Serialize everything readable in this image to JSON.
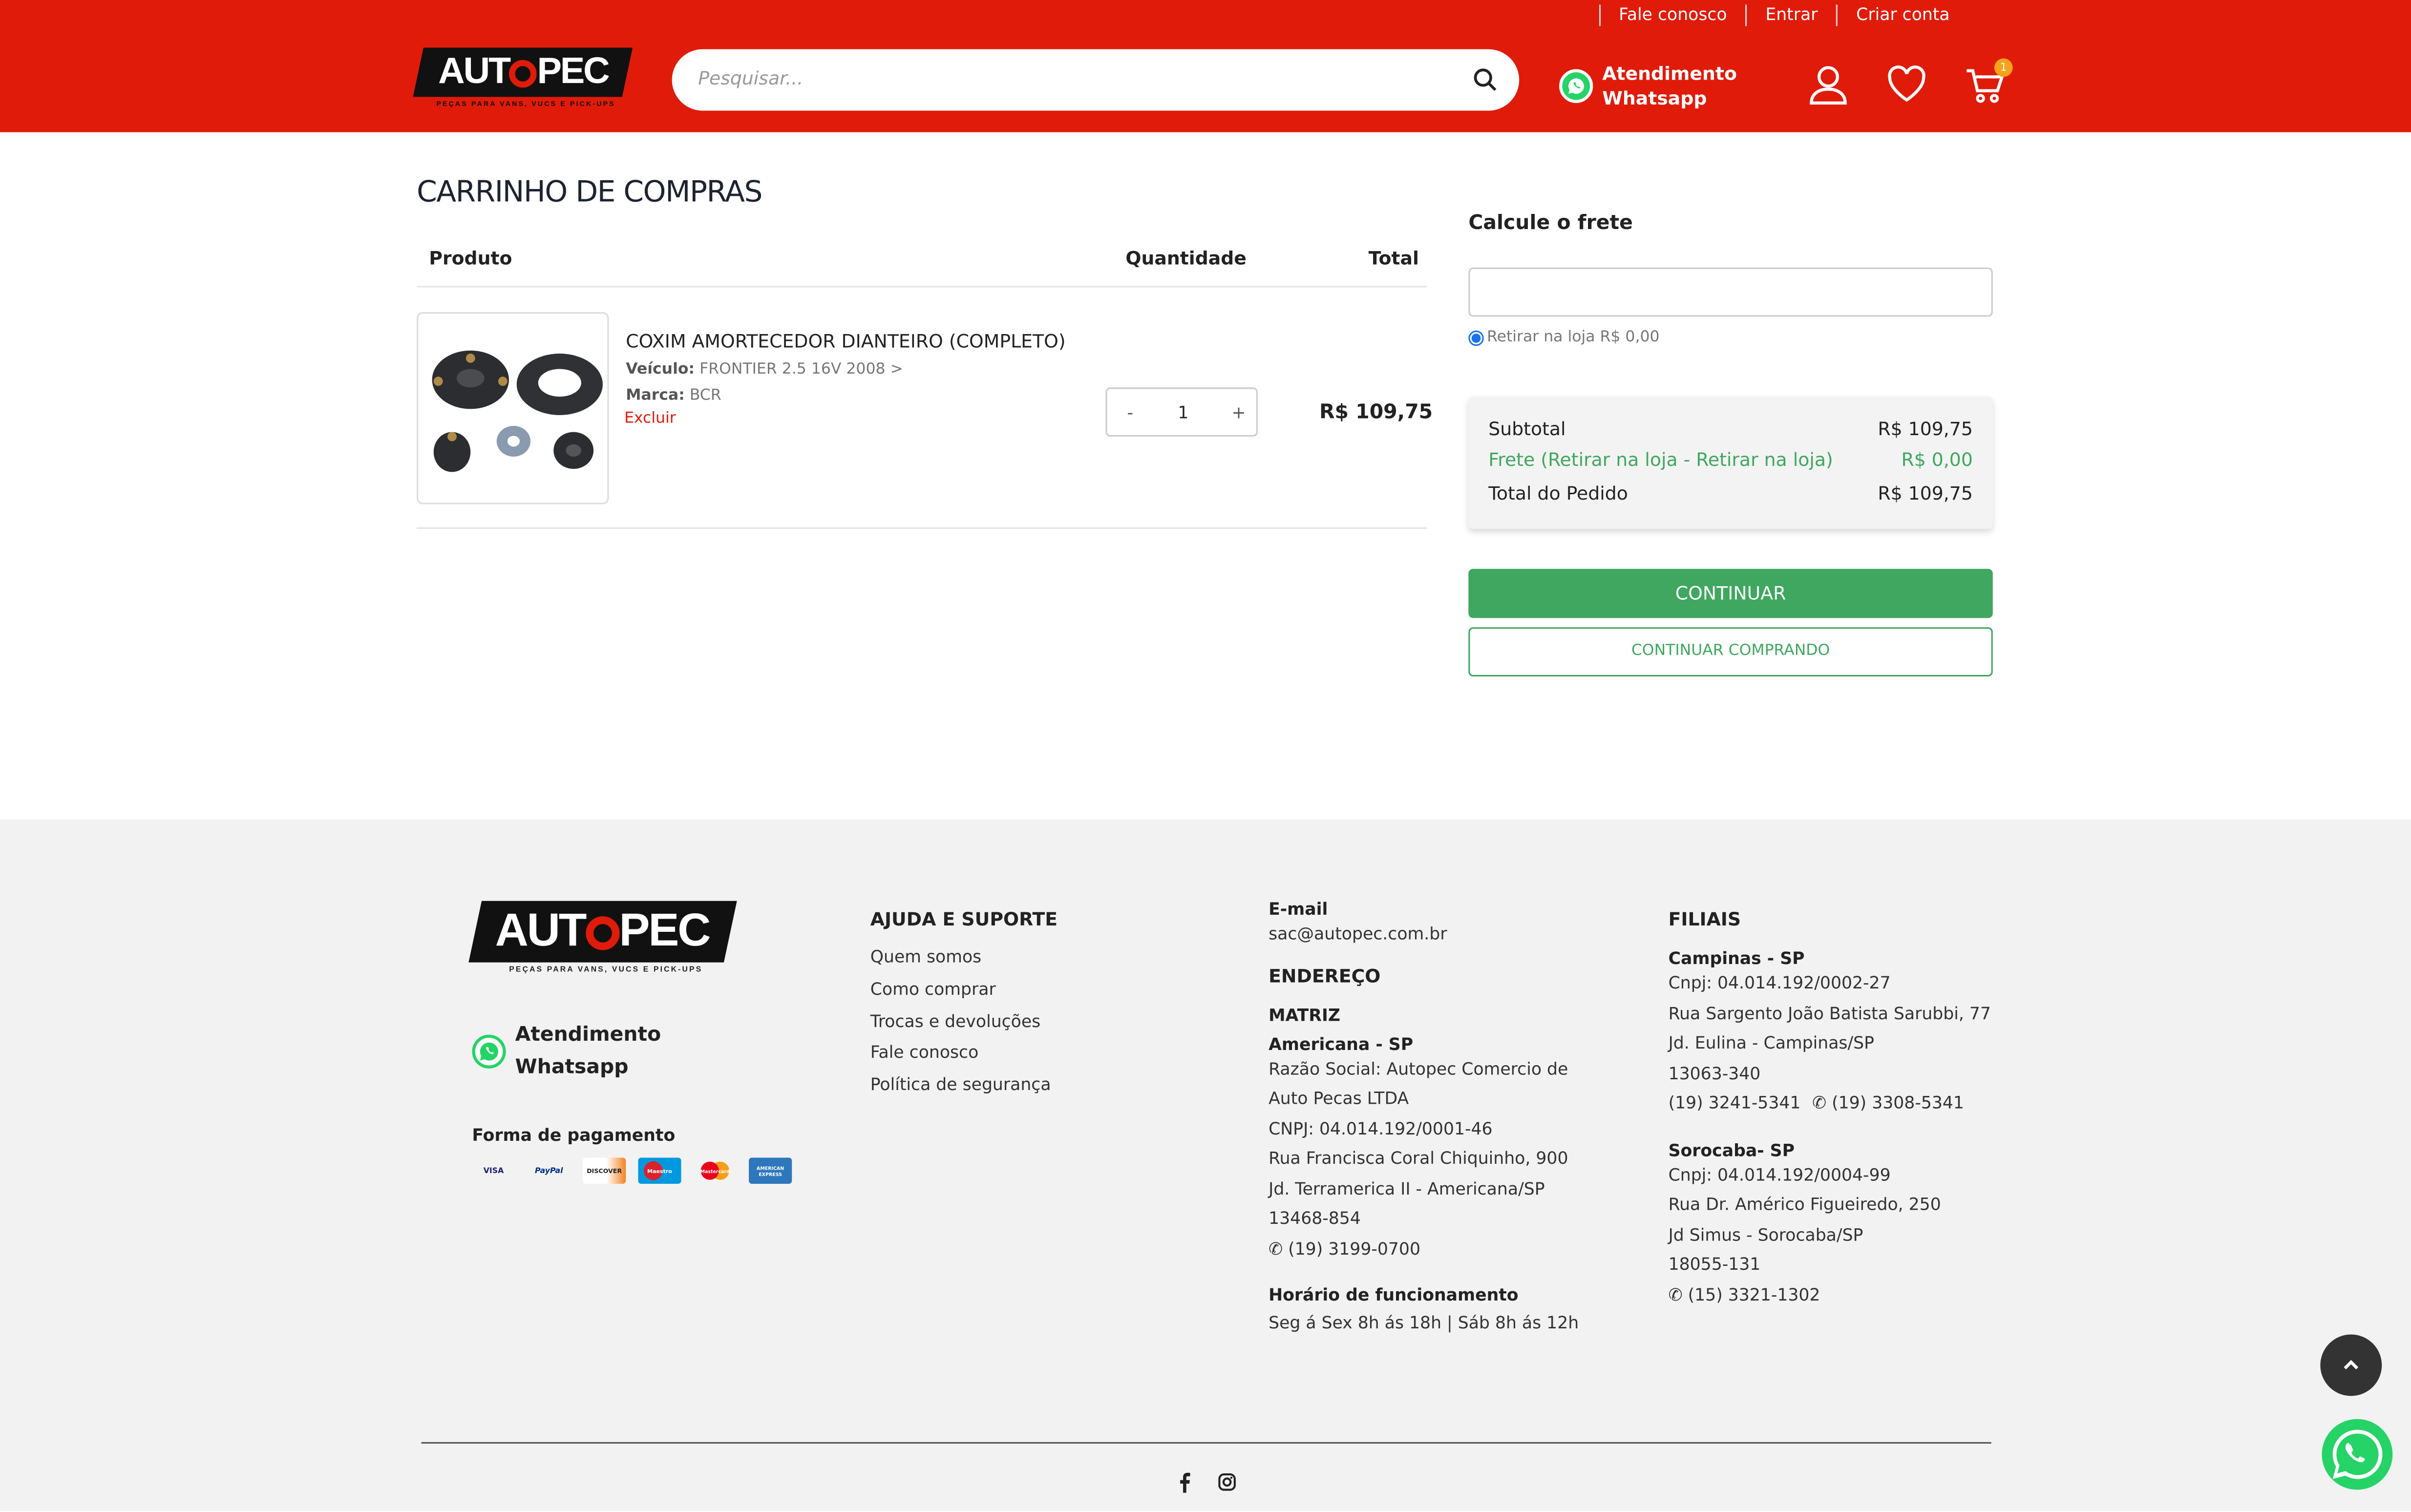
{
  "header": {
    "top_links": [
      "Fale conosco",
      "Entrar",
      "Criar conta"
    ],
    "logo_text_left": "AUT",
    "logo_text_right": "PEC",
    "logo_tagline": "PEÇAS PARA VANS, VUCS E PICK-UPS",
    "search_placeholder": "Pesquisar...",
    "whatsapp_line1": "Atendimento",
    "whatsapp_line2": "Whatsapp",
    "cart_count": "1"
  },
  "cart": {
    "title": "CARRINHO DE COMPRAS",
    "columns": {
      "product": "Produto",
      "quantity": "Quantidade",
      "total": "Total"
    },
    "item": {
      "name": "COXIM AMORTECEDOR DIANTEIRO (COMPLETO)",
      "vehicle_label": "Veículo:",
      "vehicle_value": "FRONTIER 2.5 16V 2008 >",
      "brand_label": "Marca:",
      "brand_value": "BCR",
      "remove_label": "Excluir",
      "quantity": "1",
      "minus": "-",
      "plus": "+",
      "total": "R$ 109,75"
    }
  },
  "shipping": {
    "title": "Calcule o frete",
    "input_value": "",
    "pickup_option": "Retirar na loja R$ 0,00"
  },
  "summary": {
    "subtotal_label": "Subtotal",
    "subtotal_value": "R$ 109,75",
    "freight_label": "Frete (Retirar na loja - Retirar na loja)",
    "freight_value": "R$ 0,00",
    "total_label": "Total do Pedido",
    "total_value": "R$ 109,75"
  },
  "buttons": {
    "continue": "CONTINUAR",
    "continue_shopping": "CONTINUAR COMPRANDO"
  },
  "footer": {
    "whatsapp_line1": "Atendimento",
    "whatsapp_line2": "Whatsapp",
    "payment_title": "Forma de pagamento",
    "payment_methods": [
      "VISA",
      "PayPal",
      "DISCOVER",
      "Maestro",
      "Mastercard",
      "AMERICAN EXPRESS"
    ],
    "help_title": "AJUDA E SUPORTE",
    "help_links": [
      "Quem somos",
      "Como comprar",
      "Trocas e devoluções",
      "Fale conosco",
      "Política de segurança"
    ],
    "email_title": "E-mail",
    "email_value": "sac@autopec.com.br",
    "address_title": "ENDEREÇO",
    "matriz_title": "MATRIZ",
    "matriz_city": "Americana - SP",
    "matriz_lines": [
      "Razão Social: Autopec Comercio de",
      "Auto Pecas LTDA",
      "CNPJ: 04.014.192/0001-46",
      "Rua Francisca Coral Chiquinho, 900",
      "Jd. Terramerica II - Americana/SP",
      "13468-854"
    ],
    "matriz_phone": "(19) 3199-0700",
    "hours_title": "Horário de funcionamento",
    "hours_value": "Seg á Sex 8h ás 18h | Sáb 8h ás 12h",
    "filiais_title": "FILIAIS",
    "campinas_title": "Campinas - SP",
    "campinas_lines": [
      "Cnpj: 04.014.192/0002-27",
      "Rua Sargento João Batista Sarubbi, 77",
      "Jd. Eulina - Campinas/SP",
      "13063-340"
    ],
    "campinas_phone1": "(19) 3241-5341",
    "campinas_phone2": "(19) 3308-5341",
    "sorocaba_title": "Sorocaba- SP",
    "sorocaba_lines": [
      "Cnpj: 04.014.192/0004-99",
      "Rua Dr. Américo Figueiredo, 250",
      "Jd Simus - Sorocaba/SP",
      "18055-131"
    ],
    "sorocaba_phone": "(15) 3321-1302"
  },
  "colors": {
    "brand_red": "#e01b0a",
    "green": "#3fa75f",
    "whatsapp": "#25d366"
  }
}
